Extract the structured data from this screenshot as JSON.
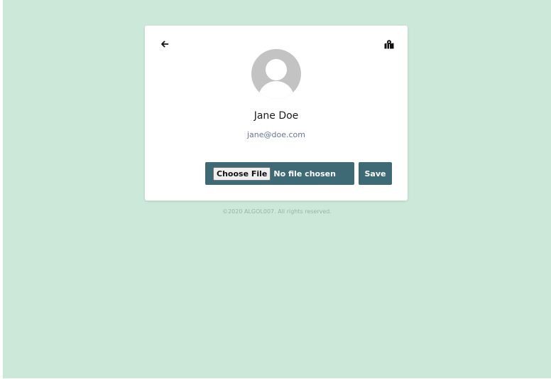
{
  "card": {
    "back_icon": "arrow-left-icon",
    "map_icon": "map-marked-icon",
    "avatar_icon": "default-user-avatar",
    "name": "Jane Doe",
    "email": "jane@doe.com"
  },
  "upload": {
    "choose_label": "Choose File",
    "status_text": "No file chosen",
    "save_label": "Save"
  },
  "footer": {
    "text": "©2020 ALGOL007. All rights reserved."
  },
  "colors": {
    "background": "#cce8d8",
    "button": "#3e6a76",
    "email": "#62769a",
    "avatar": "#c3c3c3"
  }
}
